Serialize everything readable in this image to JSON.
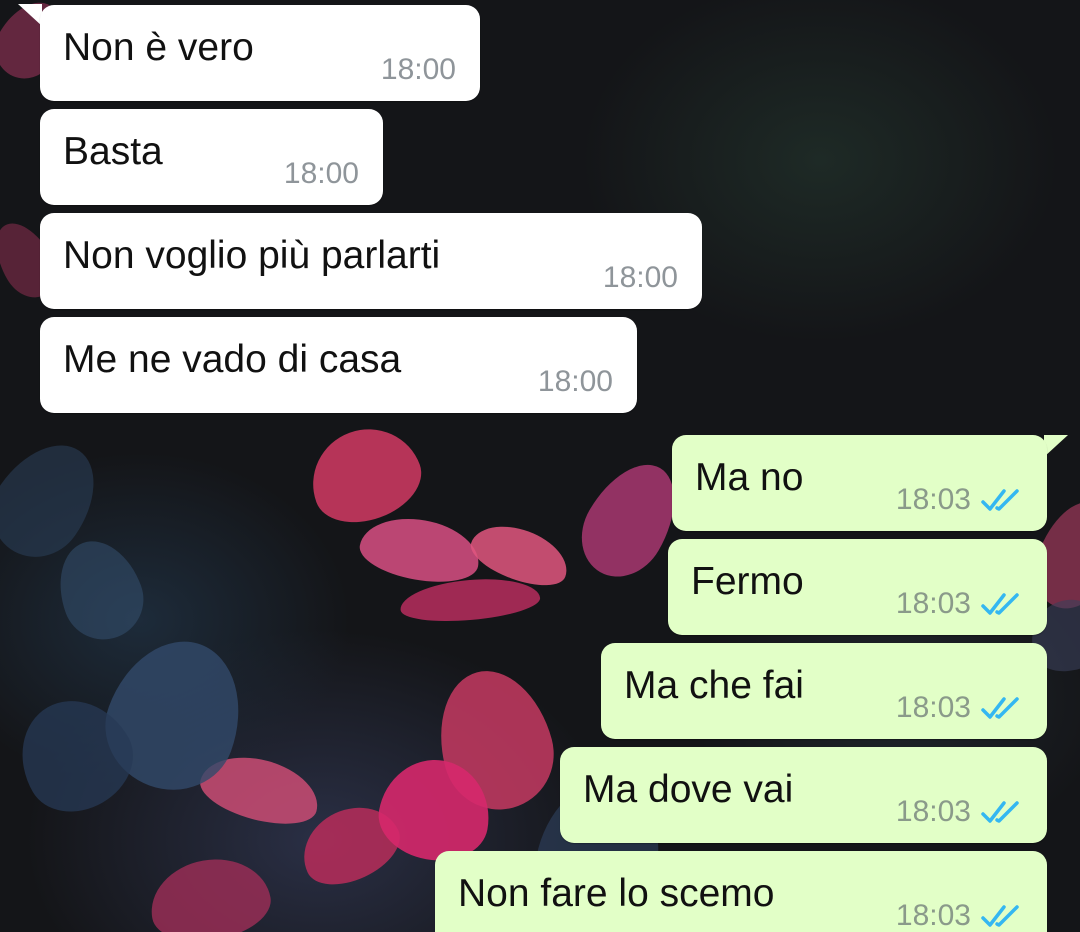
{
  "wallpaper": {
    "colors": {
      "background": "#141518",
      "leaf_pink": "#c8375f",
      "leaf_magenta": "#d6286c",
      "leaf_blue": "#324a6a",
      "leaf_dark_blue": "#273a55"
    }
  },
  "colors": {
    "incoming_bubble": "#ffffff",
    "outgoing_bubble": "#e2ffc7",
    "timestamp": "#8f959a",
    "read_ticks": "#34b7f1",
    "text": "#111111"
  },
  "messages": [
    {
      "direction": "incoming",
      "text": "Non è vero",
      "time": "18:00"
    },
    {
      "direction": "incoming",
      "text": "Basta",
      "time": "18:00"
    },
    {
      "direction": "incoming",
      "text": "Non voglio più parlarti",
      "time": "18:00"
    },
    {
      "direction": "incoming",
      "text": "Me ne vado di casa",
      "time": "18:00"
    },
    {
      "direction": "outgoing",
      "text": "Ma no",
      "time": "18:03",
      "status_icon": "double-check-read-icon"
    },
    {
      "direction": "outgoing",
      "text": "Fermo",
      "time": "18:03",
      "status_icon": "double-check-read-icon"
    },
    {
      "direction": "outgoing",
      "text": "Ma che fai",
      "time": "18:03",
      "status_icon": "double-check-read-icon"
    },
    {
      "direction": "outgoing",
      "text": "Ma dove vai",
      "time": "18:03",
      "status_icon": "double-check-read-icon"
    },
    {
      "direction": "outgoing",
      "text": "Non fare lo scemo",
      "time": "18:03",
      "status_icon": "double-check-read-icon"
    }
  ]
}
